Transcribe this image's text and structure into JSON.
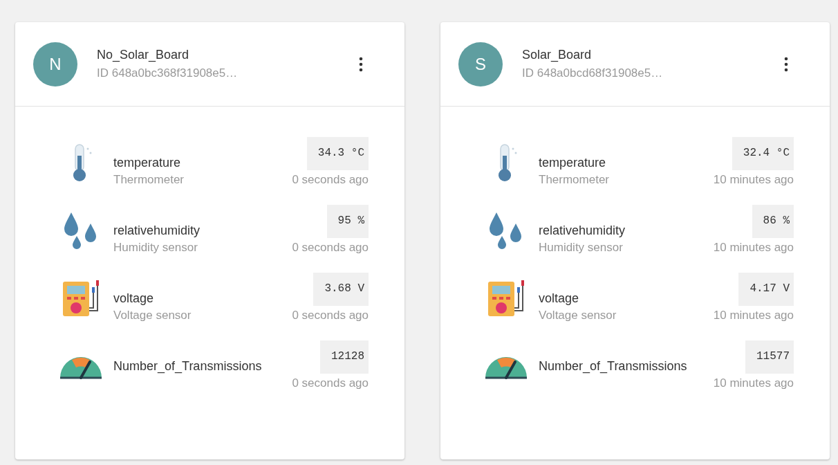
{
  "devices": [
    {
      "avatar": "N",
      "name": "No_Solar_Board",
      "id": "ID 648a0bc368f31908e5…",
      "sensors": [
        {
          "kind": "thermometer",
          "name": "temperature",
          "type": "Thermometer",
          "value": "34.3 °C",
          "time": "0 seconds ago"
        },
        {
          "kind": "humidity",
          "name": "relativehumidity",
          "type": "Humidity sensor",
          "value": "95 %",
          "time": "0 seconds ago"
        },
        {
          "kind": "multimeter",
          "name": "voltage",
          "type": "Voltage sensor",
          "value": "3.68 V",
          "time": "0 seconds ago"
        },
        {
          "kind": "gauge",
          "name": "Number_of_Transmissions",
          "value": "12128",
          "time": "0 seconds ago"
        }
      ]
    },
    {
      "avatar": "S",
      "name": "Solar_Board",
      "id": "ID 648a0bcd68f31908e5…",
      "sensors": [
        {
          "kind": "thermometer",
          "name": "temperature",
          "type": "Thermometer",
          "value": "32.4 °C",
          "time": "10 minutes ago"
        },
        {
          "kind": "humidity",
          "name": "relativehumidity",
          "type": "Humidity sensor",
          "value": "86 %",
          "time": "10 minutes ago"
        },
        {
          "kind": "multimeter",
          "name": "voltage",
          "type": "Voltage sensor",
          "value": "4.17 V",
          "time": "10 minutes ago"
        },
        {
          "kind": "gauge",
          "name": "Number_of_Transmissions",
          "value": "11577",
          "time": "10 minutes ago"
        }
      ]
    }
  ]
}
